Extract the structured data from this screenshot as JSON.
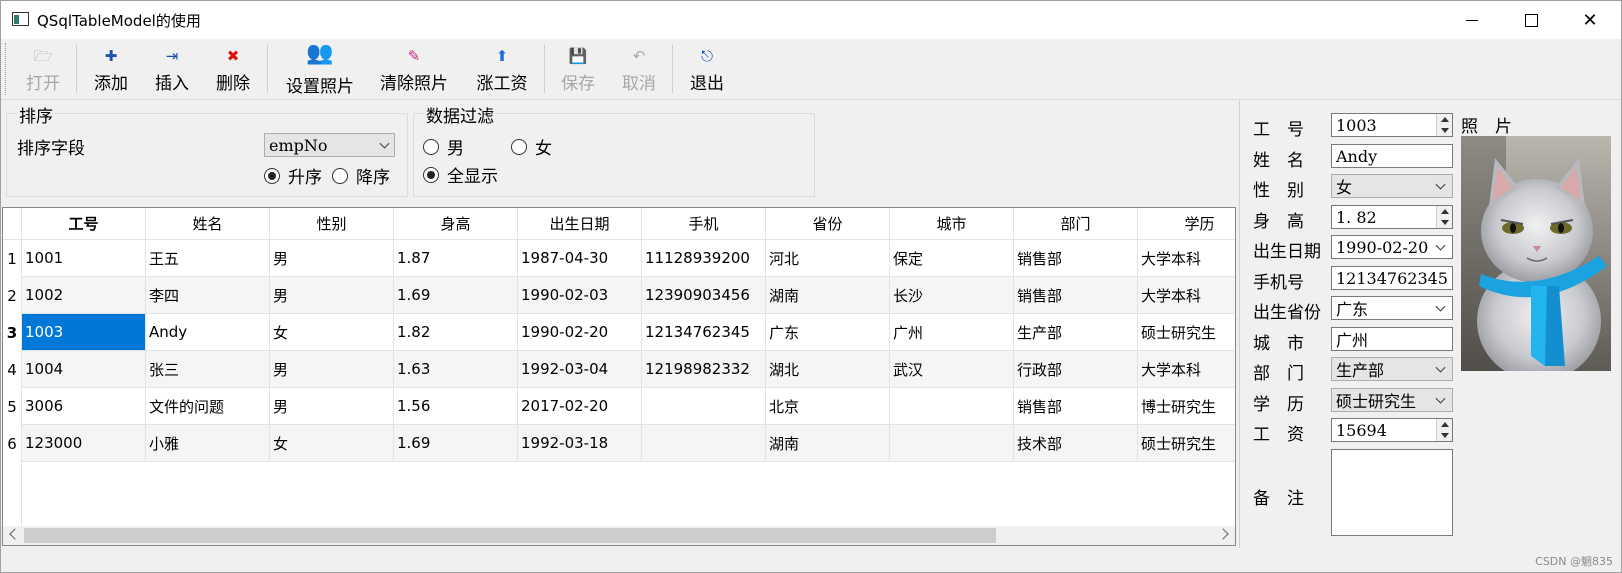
{
  "window": {
    "title": "QSqlTableModel的使用",
    "close_glyph": "✕"
  },
  "toolbar": {
    "buttons": [
      {
        "label": "打开",
        "icon": "folder-open-icon",
        "glyph": "🗁",
        "enabled": false
      },
      {
        "label": "添加",
        "icon": "add-icon",
        "glyph": "✚",
        "enabled": true
      },
      {
        "label": "插入",
        "icon": "insert-row-icon",
        "glyph": "⇥",
        "enabled": true
      },
      {
        "label": "删除",
        "icon": "delete-icon",
        "glyph": "✖",
        "enabled": true
      },
      {
        "label": "设置照片",
        "icon": "users-photo-icon",
        "glyph": "👥",
        "enabled": true
      },
      {
        "label": "清除照片",
        "icon": "clear-icon",
        "glyph": "✎",
        "enabled": true
      },
      {
        "label": "涨工资",
        "icon": "arrow-up-icon",
        "glyph": "⬆",
        "enabled": true
      },
      {
        "label": "保存",
        "icon": "save-icon",
        "glyph": "💾",
        "enabled": false
      },
      {
        "label": "取消",
        "icon": "undo-icon",
        "glyph": "↶",
        "enabled": false
      },
      {
        "label": "退出",
        "icon": "exit-icon",
        "glyph": "⎋",
        "enabled": true
      }
    ]
  },
  "sort": {
    "group_title": "排序",
    "field_label": "排序字段",
    "field_value": "empNo",
    "asc_label": "升序",
    "desc_label": "降序",
    "selected": "asc"
  },
  "filter": {
    "group_title": "数据过滤",
    "male_label": "男",
    "female_label": "女",
    "all_label": "全显示",
    "selected": "all"
  },
  "table": {
    "columns": [
      "工号",
      "姓名",
      "性别",
      "身高",
      "出生日期",
      "手机",
      "省份",
      "城市",
      "部门",
      "学历"
    ],
    "row_headers": [
      "1",
      "2",
      "3",
      "4",
      "5",
      "6"
    ],
    "current_row": 2,
    "rows": [
      [
        "1001",
        "王五",
        "男",
        "1.87",
        "1987-04-30",
        "11128939200",
        "河北",
        "保定",
        "销售部",
        "大学本科"
      ],
      [
        "1002",
        "李四",
        "男",
        "1.69",
        "1990-02-03",
        "12390903456",
        "湖南",
        "长沙",
        "销售部",
        "大学本科"
      ],
      [
        "1003",
        "Andy",
        "女",
        "1.82",
        "1990-02-20",
        "12134762345",
        "广东",
        "广州",
        "生产部",
        "硕士研究生"
      ],
      [
        "1004",
        "张三",
        "男",
        "1.63",
        "1992-03-04",
        "12198982332",
        "湖北",
        "武汉",
        "行政部",
        "大学本科"
      ],
      [
        "3006",
        "文件的问题",
        "男",
        "1.56",
        "2017-02-20",
        "",
        "北京",
        "",
        "销售部",
        "博士研究生"
      ],
      [
        "123000",
        "小雅",
        "女",
        "1.69",
        "1992-03-18",
        "",
        "湖南",
        "",
        "技术部",
        "硕士研究生"
      ]
    ]
  },
  "detail": {
    "labels": {
      "empno": "工　号",
      "name": "姓　名",
      "gender": "性　别",
      "height": "身　高",
      "birthday": "出生日期",
      "mobile": "手机号",
      "province": "出生省份",
      "city": "城　市",
      "department": "部　门",
      "education": "学　历",
      "salary": "工　资",
      "memo": "备　注",
      "photo": "照　片"
    },
    "values": {
      "empno": "1003",
      "name": "Andy",
      "gender": "女",
      "height": "1. 82",
      "birthday": "1990-02-20",
      "mobile": "12134762345",
      "province": "广东",
      "city": "广州",
      "department": "生产部",
      "education": "硕士研究生",
      "salary": "15694",
      "memo": ""
    }
  },
  "status": {
    "watermark": "CSDN @魍835"
  },
  "colors": {
    "selection": "#0078d7",
    "window_bg": "#f0f0f0"
  }
}
